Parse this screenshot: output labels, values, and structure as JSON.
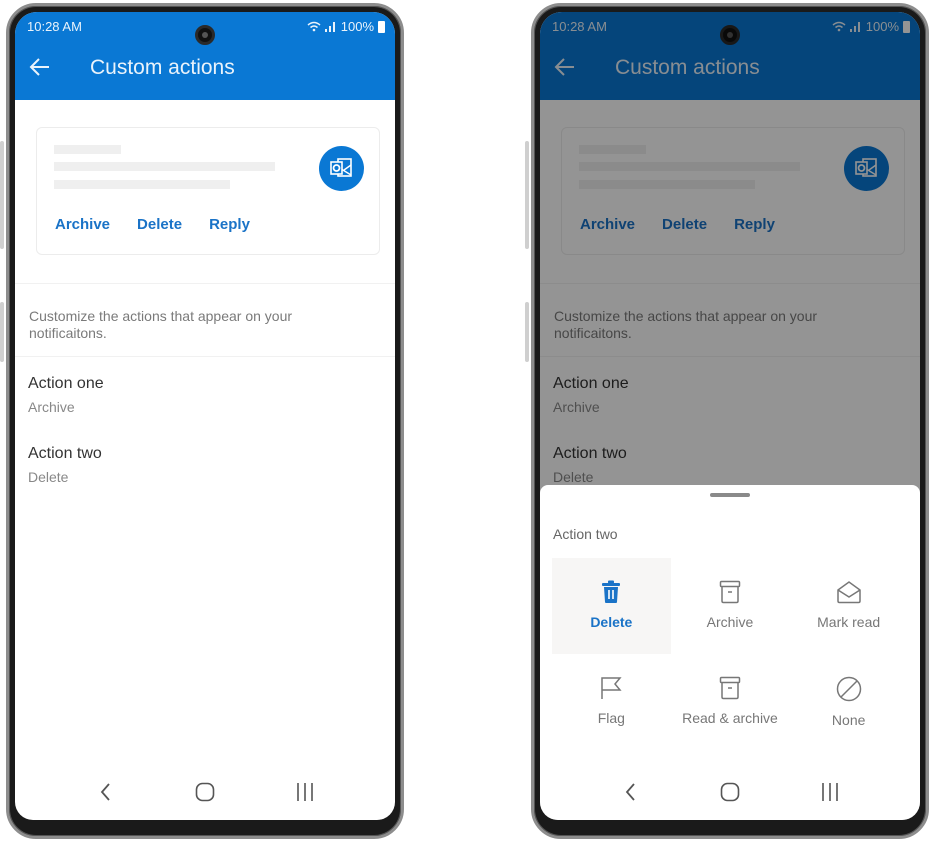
{
  "status_bar": {
    "time": "10:28 AM",
    "battery": "100%"
  },
  "appbar": {
    "title": "Custom actions"
  },
  "preview_card": {
    "actions": [
      "Archive",
      "Delete",
      "Reply"
    ]
  },
  "description": "Customize the actions that appear on your notificaitons.",
  "settings": [
    {
      "name": "Action one",
      "value": "Archive"
    },
    {
      "name": "Action two",
      "value": "Delete"
    }
  ],
  "sheet": {
    "title": "Action two",
    "selected": "Delete",
    "options": [
      {
        "label": "Delete",
        "icon": "trash-icon"
      },
      {
        "label": "Archive",
        "icon": "archive-icon"
      },
      {
        "label": "Mark read",
        "icon": "open-envelope-icon"
      },
      {
        "label": "Flag",
        "icon": "flag-icon"
      },
      {
        "label": "Read & archive",
        "icon": "archive-icon"
      },
      {
        "label": "None",
        "icon": "none-icon"
      }
    ]
  },
  "colors": {
    "accent": "#0a78d4",
    "link": "#1a73c7",
    "appbar_dimmed": "#064d8a"
  }
}
